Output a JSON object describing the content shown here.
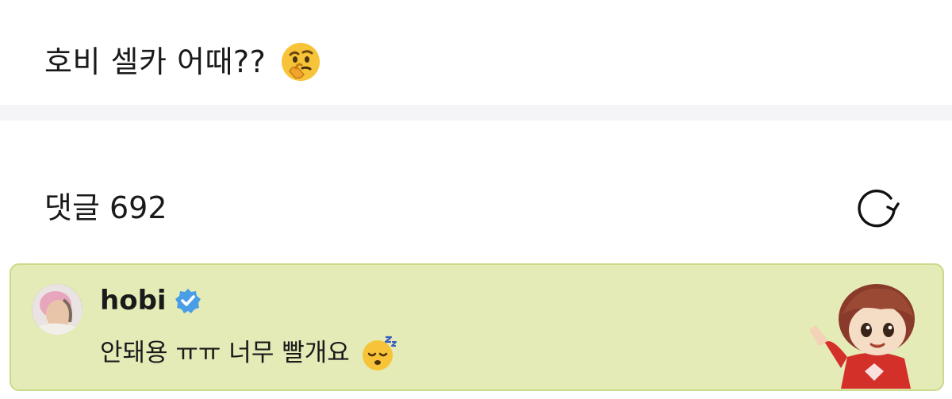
{
  "post": {
    "text": "호비 셀카 어때??",
    "emoji": "thinking-face-emoji"
  },
  "comments": {
    "label": "댓글 692",
    "refresh_icon": "refresh-icon"
  },
  "comment_card": {
    "background": "#e4ebb7",
    "border": "#cbd98a",
    "username": "hobi",
    "verified": true,
    "verified_color": "#4a9ee6",
    "text": "안돼용 ㅠㅠ 너무 빨개요",
    "emoji": "sleeping-face-emoji",
    "sticker": "chibi-character-sticker"
  }
}
